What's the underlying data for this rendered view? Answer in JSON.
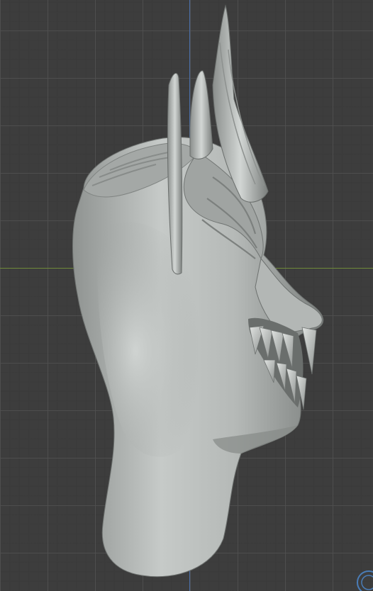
{
  "viewport": {
    "background_color": "#3d3d3d",
    "grid_color": "#505050",
    "x_axis_color": "#6f8a3a",
    "y_axis_color": "#4a6ea8",
    "model_color": "#b9bdbb"
  },
  "model": {
    "icon": "sculpted-creature-head"
  },
  "gizmo": {
    "icon": "navigation-gizmo-icon"
  }
}
